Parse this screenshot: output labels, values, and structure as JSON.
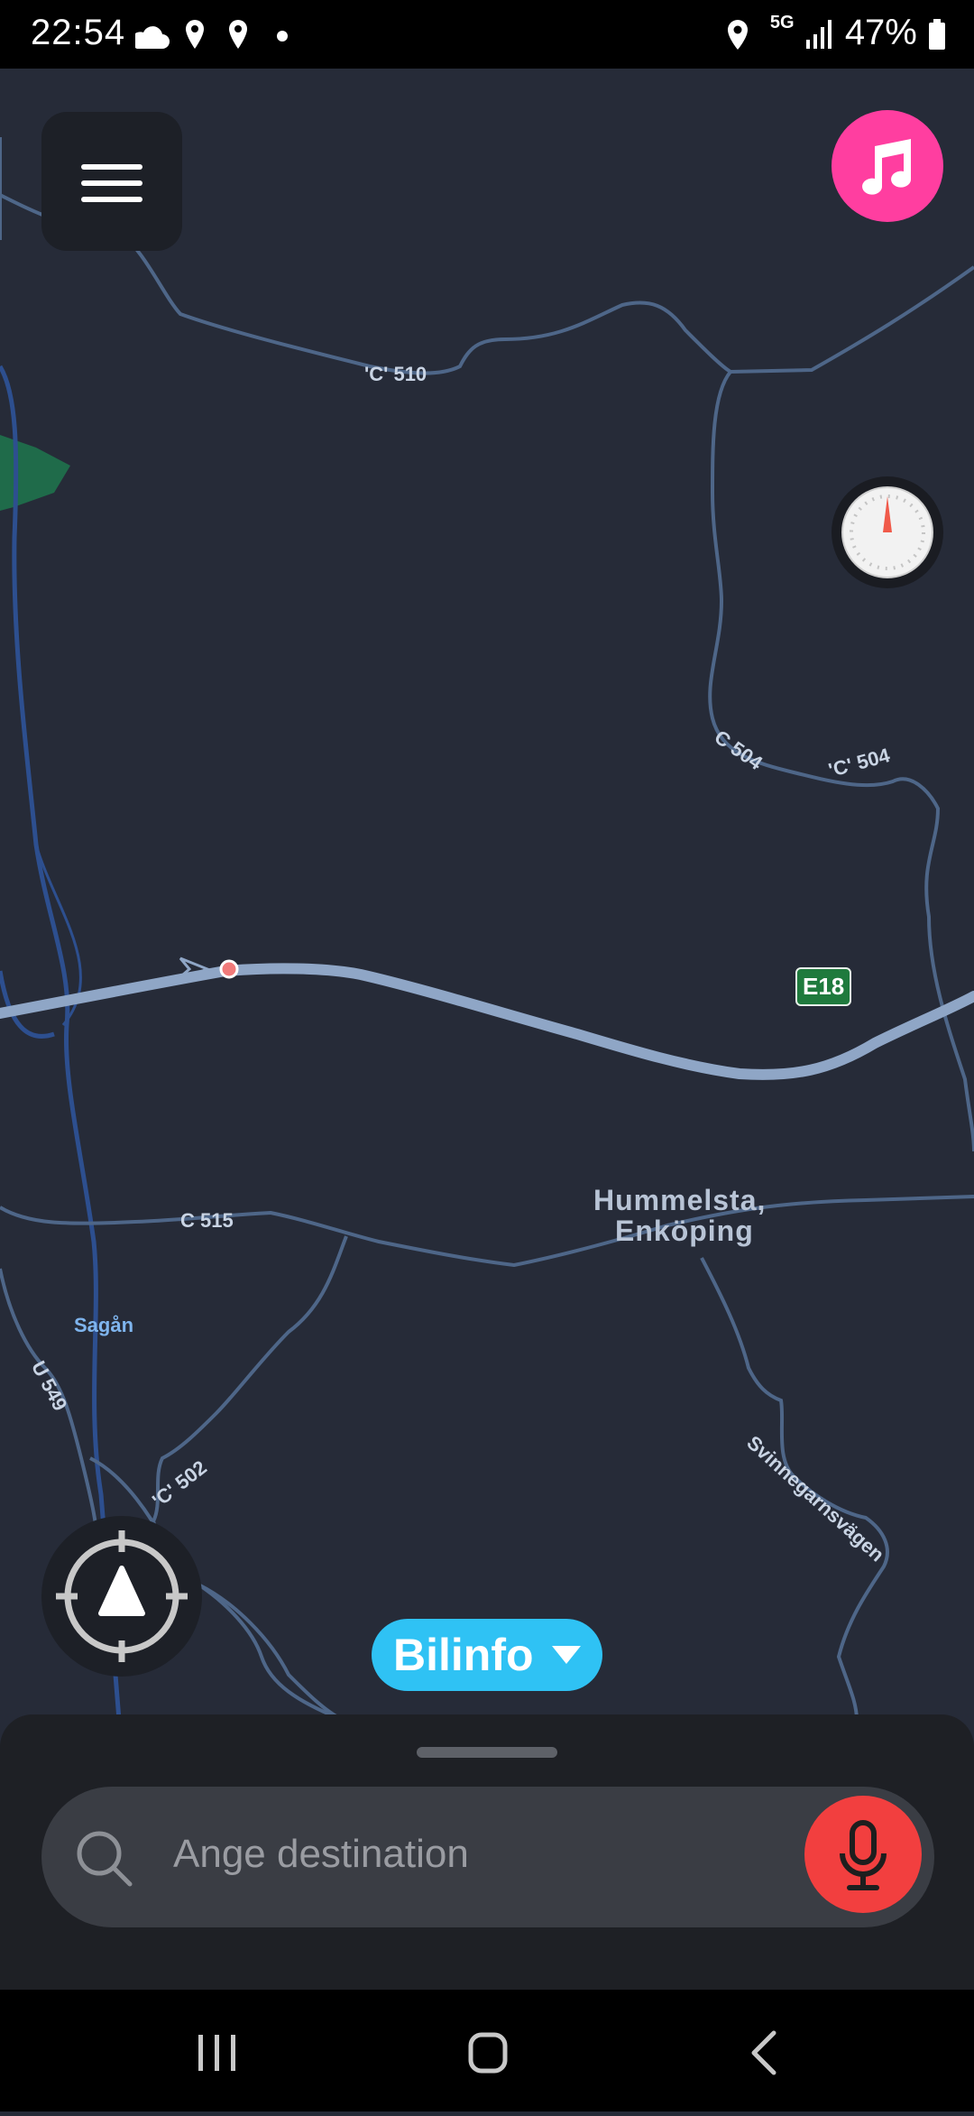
{
  "status_bar": {
    "time": "22:54",
    "network": "5G",
    "battery": "47%",
    "icons": [
      "cloud-icon",
      "location-icon",
      "location-icon",
      "dot-icon",
      "location-icon",
      "signal-icon",
      "battery-icon"
    ]
  },
  "map": {
    "labels": {
      "road_c510": "'C' 510",
      "road_c504_a": "C 504",
      "road_c504_b": "'C' 504",
      "road_e18": "E18",
      "road_c515": "C 515",
      "town_line1": "Hummelsta,",
      "town_line2": "Enköping",
      "river": "Sagån",
      "road_u549": "U 549",
      "road_c502": "'C' 502",
      "street": "Svinnegarnsvägen"
    }
  },
  "controls": {
    "menu_icon": "hamburger-icon",
    "music_icon": "music-note-icon",
    "speed_icon": "speedometer-icon",
    "locate_icon": "recenter-icon"
  },
  "bilinfo": {
    "label": "Bilinfo"
  },
  "search": {
    "placeholder": "Ange destination"
  },
  "colors": {
    "map_bg": "#262b38",
    "highway": "#8fa6c6",
    "road": "#4e6688",
    "water": "#2d4f8f",
    "music": "#ff3ea0",
    "mic": "#f23f3f",
    "bilinfo": "#2fc2f4"
  }
}
